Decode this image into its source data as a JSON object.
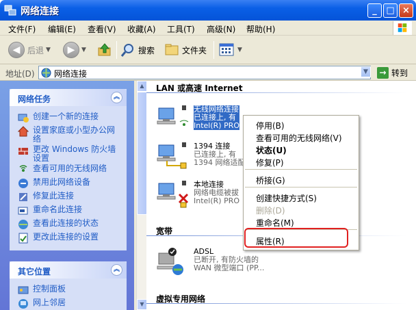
{
  "window": {
    "title": "网络连接",
    "min_glyph": "_",
    "max_glyph": "□",
    "close_glyph": "×"
  },
  "menubar": [
    "文件(F)",
    "编辑(E)",
    "查看(V)",
    "收藏(A)",
    "工具(T)",
    "高级(N)",
    "帮助(H)"
  ],
  "toolbar": {
    "back_label": "后退",
    "search_label": "搜索",
    "folders_label": "文件夹",
    "back_glyph": "◀",
    "forward_glyph": "▶",
    "dropdown_glyph": "▼"
  },
  "address": {
    "label": "地址(D)",
    "value": "网络连接",
    "go_label": "转到",
    "go_glyph": "→",
    "dropdown_glyph": "▼"
  },
  "network_tasks": {
    "title": "网络任务",
    "collapse_glyph": "︽",
    "items": [
      {
        "label": "创建一个新的连接",
        "icon": "new-connection-icon"
      },
      {
        "label": "设置家庭或小型办公网络",
        "icon": "home-network-icon"
      },
      {
        "label": "更改 Windows 防火墙设置",
        "icon": "firewall-icon"
      },
      {
        "label": "查看可用的无线网络",
        "icon": "wireless-icon"
      },
      {
        "label": "禁用此网络设备",
        "icon": "disable-icon"
      },
      {
        "label": "修复此连接",
        "icon": "repair-icon"
      },
      {
        "label": "重命名此连接",
        "icon": "rename-icon"
      },
      {
        "label": "查看此连接的状态",
        "icon": "status-icon"
      },
      {
        "label": "更改此连接的设置",
        "icon": "settings-icon"
      }
    ]
  },
  "other_places": {
    "title": "其它位置",
    "collapse_glyph": "︽",
    "items": [
      {
        "label": "控制面板",
        "icon": "control-panel-icon"
      },
      {
        "label": "网上邻居",
        "icon": "network-places-icon"
      }
    ]
  },
  "groups": {
    "lan": "LAN 或高速 Internet",
    "broadband": "宽带",
    "vpn": "虚拟专用网络"
  },
  "connections": [
    {
      "name": "无线网络连接",
      "sub1": "已连接上, 有",
      "sub2": "Intel(R) PRO",
      "selected": true
    },
    {
      "name": "1394 连接",
      "sub1": "已连接上, 有",
      "sub2": "1394 网络适配",
      "selected": false
    },
    {
      "name": "本地连接",
      "sub1": "网络电缆被拔",
      "sub2": "Intel(R) PRO",
      "selected": false
    },
    {
      "name": "ADSL",
      "sub1": "已断开, 有防火墙的",
      "sub2": "WAN 微型端口 (PP...",
      "selected": false
    }
  ],
  "context_menu": [
    {
      "label": "停用(B)"
    },
    {
      "label": "查看可用的无线网络(V)"
    },
    {
      "label": "状态(U)",
      "bold": true
    },
    {
      "label": "修复(P)"
    },
    {
      "label": "桥接(G)"
    },
    {
      "label": "创建快捷方式(S)"
    },
    {
      "label": "删除(D)",
      "disabled": true
    },
    {
      "label": "重命名(M)"
    },
    {
      "label": "属性(R)"
    }
  ],
  "colors": {
    "accent": "#215dc6",
    "selection": "#316ac5",
    "highlight_ring": "#e02020"
  }
}
